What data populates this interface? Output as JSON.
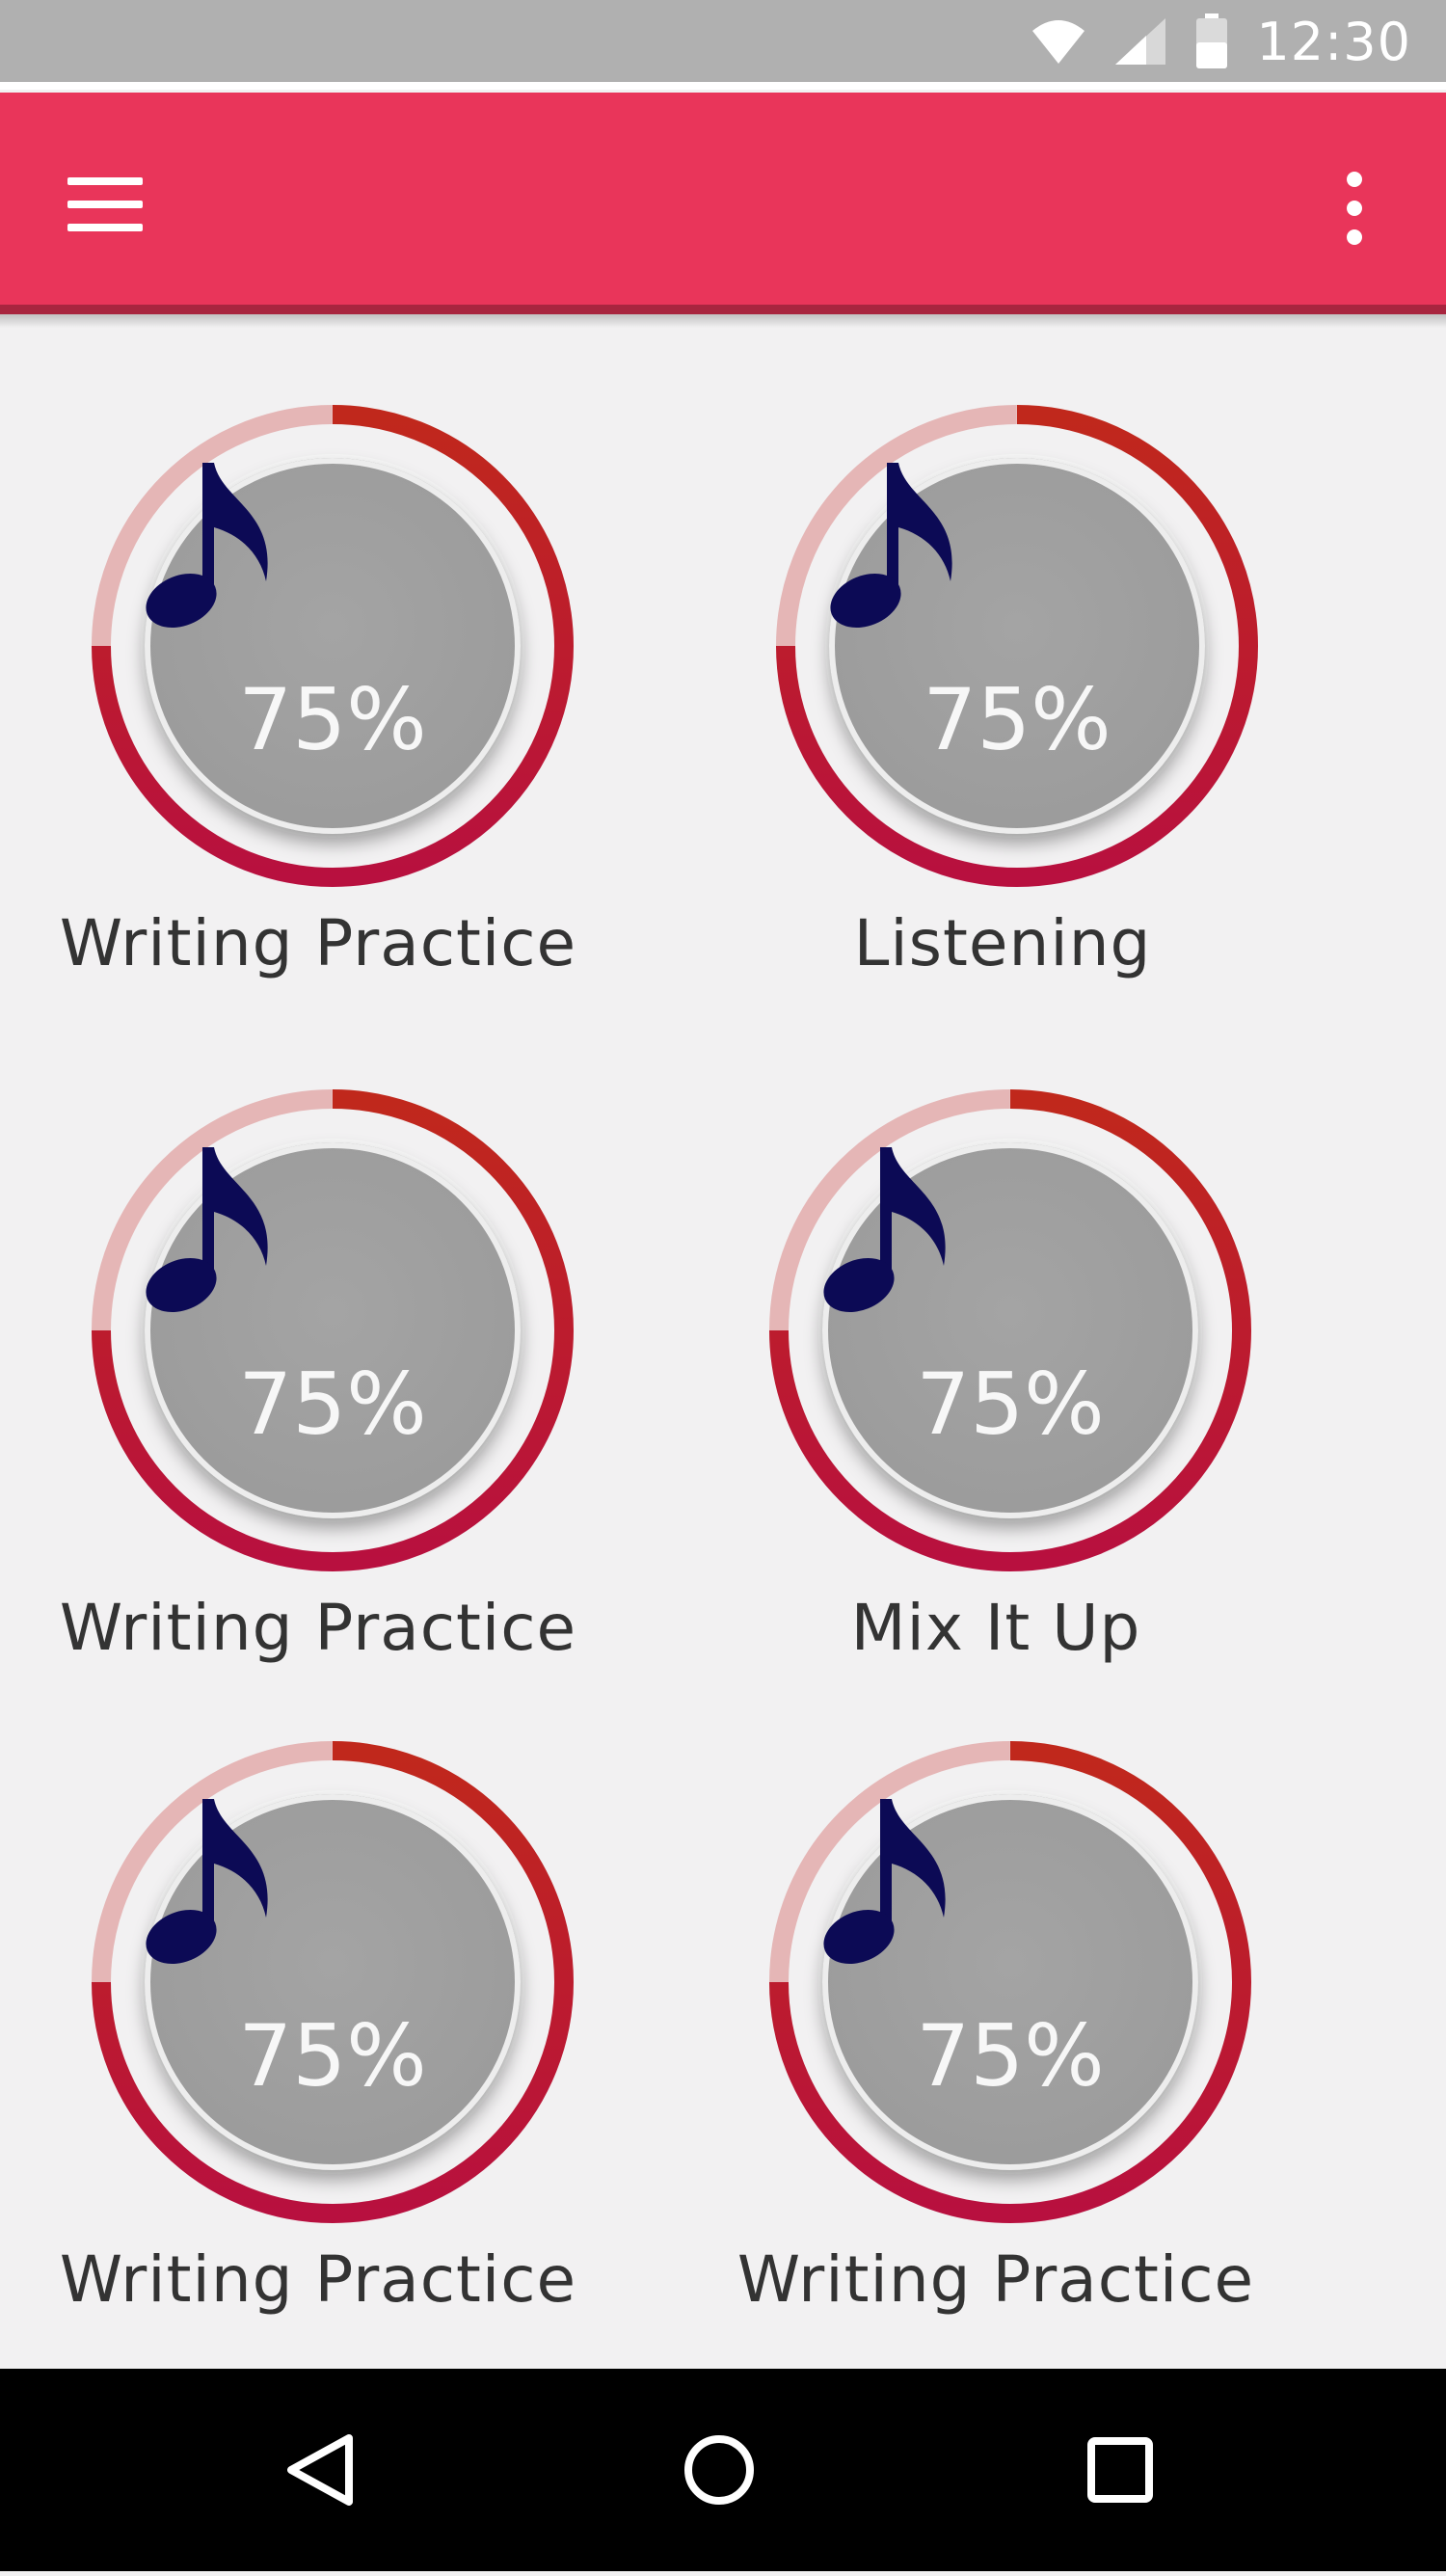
{
  "status_bar": {
    "time": "12:30",
    "icons": [
      "wifi-icon",
      "signal-icon",
      "battery-icon"
    ]
  },
  "app_bar": {
    "menu_icon": "hamburger-menu-icon",
    "overflow_icon": "overflow-menu-icon",
    "color": "#e9355a"
  },
  "tiles": [
    {
      "label": "Writing Practice",
      "percent": "75%",
      "progress": 0.75,
      "icon": "music-note-icon"
    },
    {
      "label": "Listening",
      "percent": "75%",
      "progress": 0.75,
      "icon": "music-note-icon"
    },
    {
      "label": "Writing Practice",
      "percent": "75%",
      "progress": 0.75,
      "icon": "music-note-icon"
    },
    {
      "label": "Mix It Up",
      "percent": "75%",
      "progress": 0.75,
      "icon": "music-note-icon"
    },
    {
      "label": "Writing Practice",
      "percent": "75%",
      "progress": 0.75,
      "icon": "music-note-icon"
    },
    {
      "label": "Writing Practice",
      "percent": "75%",
      "progress": 0.75,
      "icon": "music-note-icon"
    }
  ],
  "colors": {
    "ring_progress_start": "#c0281c",
    "ring_progress_end": "#b8103f",
    "ring_track": "#e5b6b6",
    "note": "#0c0a55",
    "disc": "#9e9e9e"
  },
  "nav_bar": {
    "buttons": [
      "back-icon",
      "home-icon",
      "recents-icon"
    ]
  }
}
